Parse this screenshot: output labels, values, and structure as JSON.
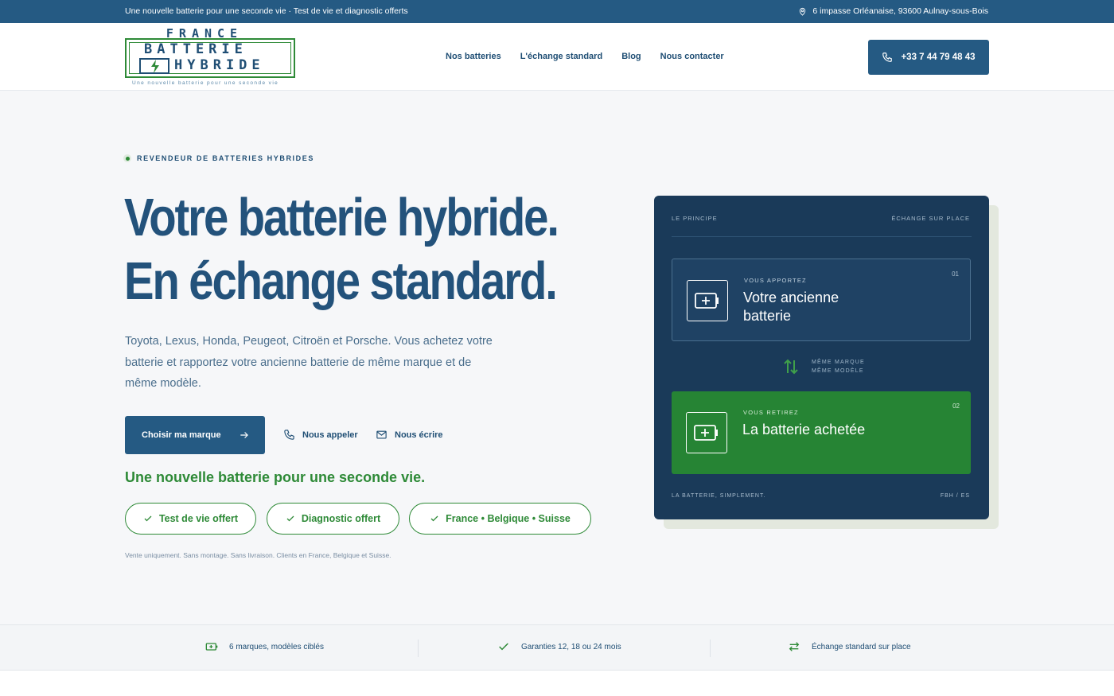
{
  "topbar": {
    "announcement": "Une nouvelle batterie pour une seconde vie · Test de vie et diagnostic offerts",
    "address": "6 impasse Orléanaise, 93600 Aulnay-sous-Bois",
    "address_icon": "map-pin-icon"
  },
  "header": {
    "logo": {
      "line1": "FRANCE",
      "line2": "BATTERIE",
      "line3": "HYBRIDE",
      "tagline": "Une nouvelle batterie pour une seconde vie"
    },
    "nav": [
      "Nos batteries",
      "L'échange standard",
      "Blog",
      "Nous contacter"
    ],
    "phone": "+33 7 44 79 48 43"
  },
  "hero": {
    "eyebrow": "REVENDEUR DE BATTERIES HYBRIDES",
    "title_line1": "Votre batterie hybride.",
    "title_line2": "En échange standard.",
    "lead": "Toyota, Lexus, Honda, Peugeot, Citroën et Porsche. Vous achetez votre batterie et rapportez votre ancienne batterie de même marque et de même modèle.",
    "cta_label": "Choisir ma marque",
    "call_label": "Nous appeler",
    "write_label": "Nous écrire",
    "slogan": "Une nouvelle batterie pour une seconde vie.",
    "pills": [
      "Test de vie offert",
      "Diagnostic offert",
      "France • Belgique • Suisse"
    ],
    "note": "Vente uniquement. Sans montage. Sans livraison. Clients en France, Belgique et Suisse."
  },
  "card": {
    "caption_left": "LE PRINCIPE",
    "caption_right": "ÉCHANGE SUR PLACE",
    "step1": {
      "label": "VOUS APPORTEZ",
      "title": "Votre ancienne batterie",
      "num": "01"
    },
    "swap_line1": "MÊME MARQUE",
    "swap_line2": "MÊME MODÈLE",
    "step2": {
      "label": "VOUS RETIREZ",
      "title": "La batterie achetée",
      "num": "02"
    },
    "footer_left": "LA BATTERIE, SIMPLEMENT.",
    "footer_right": "FBH / ES"
  },
  "features": [
    {
      "icon": "battery-icon",
      "text": "6 marques, modèles ciblés"
    },
    {
      "icon": "check-icon",
      "text": "Garanties 12, 18 ou 24 mois"
    },
    {
      "icon": "swap-icon",
      "text": "Échange standard sur place"
    }
  ],
  "colors": {
    "brand_blue": "#255a83",
    "dark_navy": "#1a3a59",
    "accent_green": "#2e8a37",
    "background": "#f6f7f9"
  }
}
